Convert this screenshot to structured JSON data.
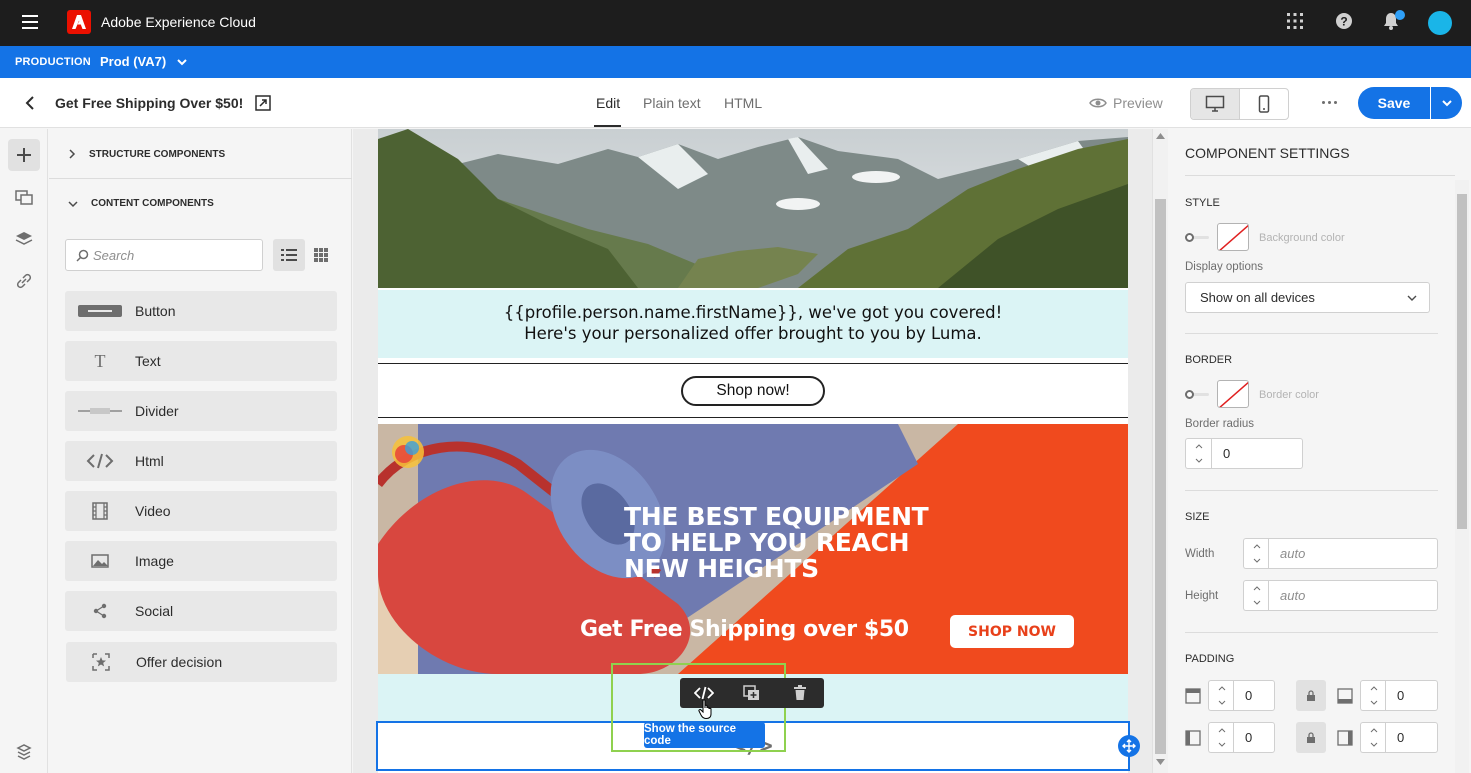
{
  "app": {
    "title": "Adobe Experience Cloud"
  },
  "env": {
    "label": "PRODUCTION",
    "name": "Prod (VA7)"
  },
  "header": {
    "page_title": "Get Free Shipping Over $50!",
    "tabs": [
      {
        "label": "Edit"
      },
      {
        "label": "Plain text"
      },
      {
        "label": "HTML"
      }
    ],
    "preview_label": "Preview",
    "save_label": "Save"
  },
  "components": {
    "structure_label": "STRUCTURE COMPONENTS",
    "content_label": "CONTENT COMPONENTS",
    "search_placeholder": "Search",
    "items": [
      {
        "label": "Button",
        "icon": "button-icon"
      },
      {
        "label": "Text",
        "icon": "text-icon"
      },
      {
        "label": "Divider",
        "icon": "divider-icon"
      },
      {
        "label": "Html",
        "icon": "code-icon"
      },
      {
        "label": "Video",
        "icon": "video-icon"
      },
      {
        "label": "Image",
        "icon": "image-icon"
      },
      {
        "label": "Social",
        "icon": "share-icon"
      },
      {
        "label": "Offer decision",
        "icon": "offer-decision-icon"
      }
    ]
  },
  "email": {
    "greeting_line1": "{{profile.person.name.firstName}}, we've got you covered!",
    "greeting_line2": "Here's your personalized offer brought to you by Luma.",
    "shop_button": "Shop now!",
    "banner_line1": "THE BEST EQUIPMENT",
    "banner_line2": "TO HELP YOU REACH",
    "banner_line3": "NEW HEIGHTS",
    "banner_shipping": "Get Free Shipping over $50",
    "banner_cta": "SHOP NOW",
    "tooltip": "Show the source code",
    "code_glyph": "</>"
  },
  "settings": {
    "title": "COMPONENT SETTINGS",
    "style_label": "STYLE",
    "background_color_label": "Background color",
    "display_options_label": "Display options",
    "display_options_value": "Show on all devices",
    "border_label": "BORDER",
    "border_color_label": "Border color",
    "border_radius_label": "Border radius",
    "border_radius_value": "0",
    "size_label": "SIZE",
    "width_label": "Width",
    "width_placeholder": "auto",
    "height_label": "Height",
    "height_placeholder": "auto",
    "padding_label": "PADDING",
    "padding_top": "0",
    "padding_bottom": "0",
    "padding_left": "0",
    "padding_right": "0"
  },
  "colors": {
    "accent": "#1473e6",
    "topbar": "#1d1d1d",
    "selection": "#8fd14f",
    "light_cyan": "#dbf4f5"
  }
}
